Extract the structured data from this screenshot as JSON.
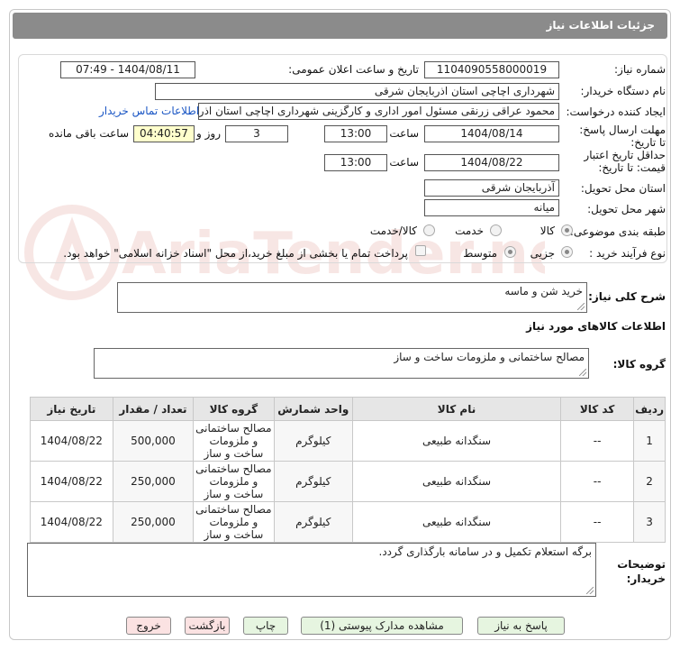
{
  "header": {
    "title": "جزئیات اطلاعات نیاز"
  },
  "watermark": {
    "text": "AriaTender.neT"
  },
  "form": {
    "need_number_label": "شماره نیاز:",
    "need_number": "1104090558000019",
    "announce_label": "تاریخ و ساعت اعلان عمومی:",
    "announce_value": "1404/08/11 - 07:49",
    "buyer_org_label": "نام دستگاه خریدار:",
    "buyer_org": "شهرداری اچاچی استان اذربایجان شرقی",
    "creator_label": "ایجاد کننده درخواست:",
    "creator": "محمود عراقی زرنقی مسئول امور اداری و کارگزینی شهرداری اچاچی استان اذربایجان شرقی",
    "contact_link": "اطلاعات تماس خریدار",
    "reply_deadline_label": "مهلت ارسال پاسخ: تا تاریخ:",
    "reply_date": "1404/08/14",
    "time_label": "ساعت",
    "reply_time": "13:00",
    "days_value": "3",
    "days_and_label": "روز و",
    "remaining_time": "04:40:57",
    "remaining_label": "ساعت باقی مانده",
    "validity_label": "حداقل تاریخ اعتبار قیمت: تا تاریخ:",
    "validity_date": "1404/08/22",
    "validity_time": "13:00",
    "province_label": "استان محل تحویل:",
    "province": "آذربایجان شرقی",
    "city_label": "شهر محل تحویل:",
    "city": "میانه",
    "category_label": "طبقه بندی موضوعی:",
    "category_options": [
      "کالا",
      "خدمت",
      "کالا/خدمت"
    ],
    "category_selected": "کالا",
    "process_label": "نوع فرآیند خرید :",
    "process_options": [
      "جزیی",
      "متوسط"
    ],
    "process_selected": "جزیی",
    "payment_note": "پرداخت تمام یا بخشی از مبلغ خرید،از محل \"اسناد خزانه اسلامی\" خواهد بود."
  },
  "summary": {
    "label": "شرح کلی نیاز:",
    "value": "خرید شن و ماسه"
  },
  "goods_section_title": "اطلاعات کالاهای مورد نیاز",
  "goods_group": {
    "label": "گروه کالا:",
    "value": "مصالح ساختمانی و ملزومات ساخت و ساز"
  },
  "table": {
    "headers": [
      "ردیف",
      "کد کالا",
      "نام کالا",
      "واحد شمارش",
      "گروه کالا",
      "تعداد / مقدار",
      "تاریخ نیاز"
    ],
    "rows": [
      [
        "1",
        "--",
        "سنگدانه طبیعی",
        "کیلوگرم",
        "مصالح ساختمانی و ملزومات ساخت و ساز",
        "500,000",
        "1404/08/22"
      ],
      [
        "2",
        "--",
        "سنگدانه طبیعی",
        "کیلوگرم",
        "مصالح ساختمانی و ملزومات ساخت و ساز",
        "250,000",
        "1404/08/22"
      ],
      [
        "3",
        "--",
        "سنگدانه طبیعی",
        "کیلوگرم",
        "مصالح ساختمانی و ملزومات ساخت و ساز",
        "250,000",
        "1404/08/22"
      ]
    ]
  },
  "buyer_notes": {
    "label": "توضیحات خریدار:",
    "value": "برگه استعلام تکمیل و در سامانه بارگذاری گردد."
  },
  "buttons": {
    "reply": "پاسخ به نیاز",
    "attachments": "مشاهده مدارک پیوستی (1)",
    "print": "چاپ",
    "back": "بازگشت",
    "exit": "خروج"
  }
}
